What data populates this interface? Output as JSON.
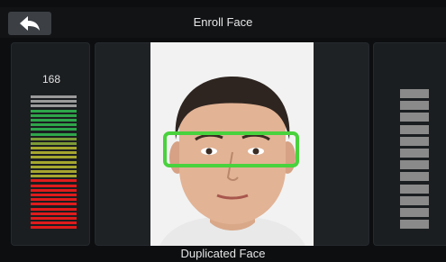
{
  "header": {
    "title": "Enroll Face"
  },
  "left_meter": {
    "count": "168",
    "bar_colors": [
      "#9a9a9a",
      "#9a9a9a",
      "#9a9a9a",
      "#2ea54a",
      "#2ea54a",
      "#2ea54a",
      "#2ea54a",
      "#2ea54a",
      "#2ea54a",
      "#7e9b36",
      "#7e9b36",
      "#a6a62f",
      "#a6a62f",
      "#a6a62f",
      "#a6a62f",
      "#a6a62f",
      "#a6a62f",
      "#a6a62f",
      "#e01b1b",
      "#e01b1b",
      "#e01b1b",
      "#e01b1b",
      "#e01b1b",
      "#e01b1b",
      "#e01b1b",
      "#e01b1b",
      "#e01b1b",
      "#e01b1b",
      "#e01b1b"
    ]
  },
  "right_meter": {
    "bar_count": 12,
    "bar_color": "#8a8a8a"
  },
  "status": {
    "message": "Duplicated Face"
  },
  "colors": {
    "accent_green": "#49d23d",
    "header_bg": "#111315",
    "panel_bg": "#1b1e21"
  }
}
